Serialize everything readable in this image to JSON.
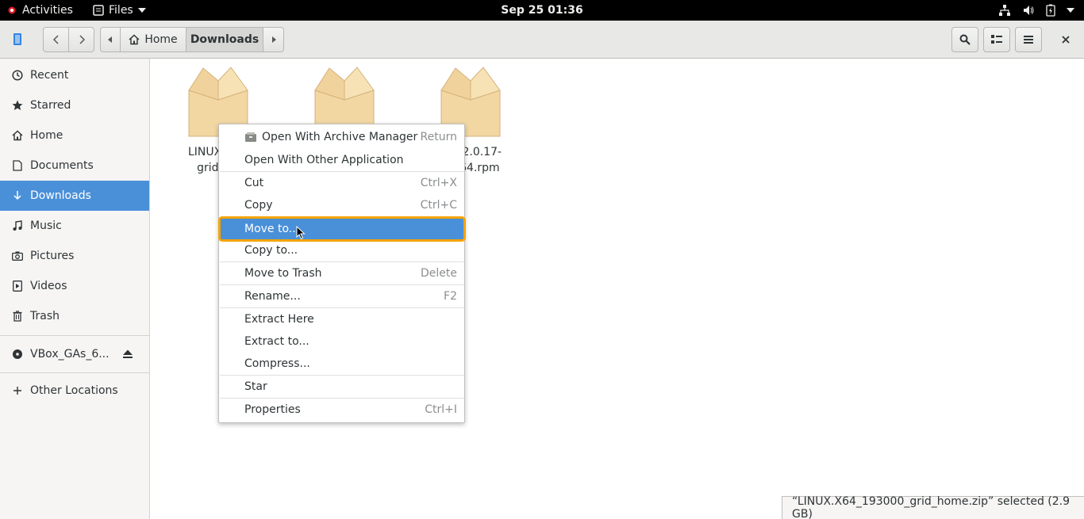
{
  "topbar": {
    "activities": "Activities",
    "app_menu": "Files",
    "clock": "Sep 25  01:36"
  },
  "header": {
    "path": [
      "Home",
      "Downloads"
    ]
  },
  "sidebar": {
    "items": [
      {
        "label": "Recent",
        "icon": "clock-icon"
      },
      {
        "label": "Starred",
        "icon": "star-icon"
      },
      {
        "label": "Home",
        "icon": "home-icon"
      },
      {
        "label": "Documents",
        "icon": "document-icon"
      },
      {
        "label": "Downloads",
        "icon": "download-icon",
        "active": true
      },
      {
        "label": "Music",
        "icon": "music-icon"
      },
      {
        "label": "Pictures",
        "icon": "camera-icon"
      },
      {
        "label": "Videos",
        "icon": "video-icon"
      },
      {
        "label": "Trash",
        "icon": "trash-icon"
      }
    ],
    "device": {
      "label": "VBox_GAs_6...",
      "icon": "disc-icon"
    },
    "other": {
      "label": "Other Locations",
      "icon": "plus-icon"
    }
  },
  "files": [
    {
      "line1": "LINUX.X64",
      "line2": "grid_ho",
      "selected": true
    },
    {
      "line1": "",
      "line2": ""
    },
    {
      "line1": "nlib-2.0.17-",
      "line2": "86_64.rpm"
    }
  ],
  "context_menu": {
    "items": [
      {
        "label": "Open With Archive Manager",
        "accel": "Return"
      },
      {
        "label": "Open With Other Application",
        "accel": ""
      },
      {
        "label": "Cut",
        "accel": "Ctrl+X"
      },
      {
        "label": "Copy",
        "accel": "Ctrl+C"
      },
      {
        "label": "Move to...",
        "accel": "",
        "highlighted": true
      },
      {
        "label": "Copy to...",
        "accel": ""
      },
      {
        "label": "Move to Trash",
        "accel": "Delete"
      },
      {
        "label": "Rename...",
        "accel": "F2"
      },
      {
        "label": "Extract Here",
        "accel": ""
      },
      {
        "label": "Extract to...",
        "accel": ""
      },
      {
        "label": "Compress...",
        "accel": ""
      },
      {
        "label": "Star",
        "accel": ""
      },
      {
        "label": "Properties",
        "accel": "Ctrl+I"
      }
    ]
  },
  "status": "“LINUX.X64_193000_grid_home.zip” selected  (2.9 GB)",
  "colors": {
    "accent": "#4a90d9",
    "focus": "#f5a400"
  }
}
